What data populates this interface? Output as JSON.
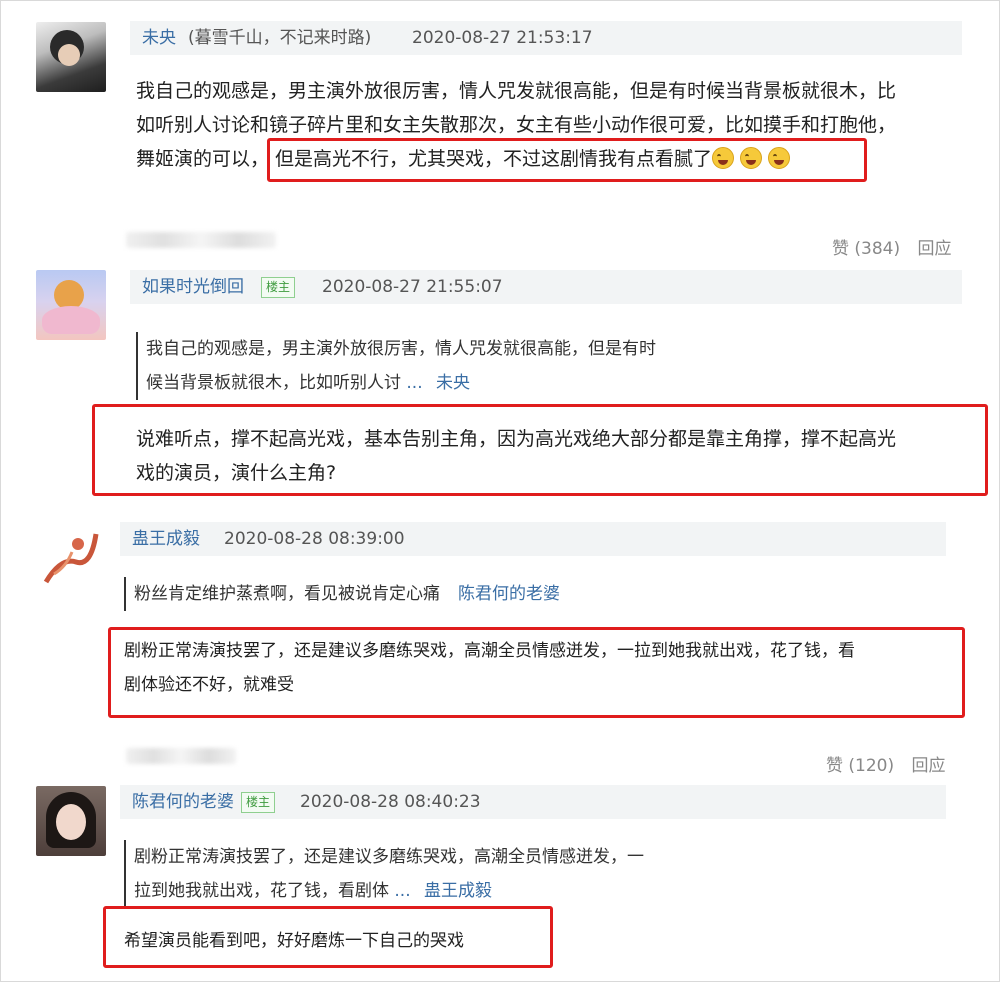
{
  "comments": [
    {
      "user": "未央",
      "user_note": "(暮雪千山，不记来时路)",
      "time": "2020-08-27 21:53:17",
      "text_line1": "我自己的观感是，男主演外放很厉害，情人咒发就很高能，但是有时候当背景板就很木，比",
      "text_line2": "如听别人讨论和镜子碎片里和女主失散那次，女主有些小动作很可爱，比如摸手和打胞他，",
      "text_line3_a": "舞姬演的可以，",
      "text_line3_b": "但是高光不行，尤其哭戏，不过这剧情我有点看腻了",
      "emoji_icon": "laugh-cry-emoji"
    },
    {
      "like_label": "赞 (384)",
      "reply_label": "回应"
    },
    {
      "user": "如果时光倒回",
      "badge": "楼主",
      "time": "2020-08-27 21:55:07",
      "quote_line1": "我自己的观感是，男主演外放很厉害，情人咒发就很高能，但是有时",
      "quote_line2": "候当背景板就很木，比如听别人讨",
      "quote_more": "...",
      "quote_author": "未央",
      "text_line1": "说难听点，撑不起高光戏，基本告别主角，因为高光戏绝大部分都是靠主角撑，撑不起高光",
      "text_line2": "戏的演员，演什么主角?"
    },
    {
      "user": "蛊王成毅",
      "time": "2020-08-28 08:39:00",
      "quote_line1": "粉丝肯定维护蒸煮啊，看见被说肯定心痛",
      "quote_author": "陈君何的老婆",
      "text_line1": "剧粉正常涛演技罢了，还是建议多磨练哭戏，高潮全员情感迸发，一拉到她我就出戏，花了钱，看",
      "text_line2": "剧体验还不好，就难受",
      "like_label": "赞 (120)",
      "reply_label": "回应"
    },
    {
      "user": "陈君何的老婆",
      "badge": "楼主",
      "time": "2020-08-28 08:40:23",
      "quote_line1": "剧粉正常涛演技罢了，还是建议多磨练哭戏，高潮全员情感迸发，一",
      "quote_line2": "拉到她我就出戏，花了钱，看剧体",
      "quote_more": "...",
      "quote_author": "蛊王成毅",
      "text_line1": "希望演员能看到吧，好好磨炼一下自己的哭戏"
    }
  ],
  "colors": {
    "username": "#3a6ea5",
    "highlight_box": "#e01d1d",
    "header_bar": "#f2f4f5",
    "badge_green": "#3f9b3f"
  }
}
